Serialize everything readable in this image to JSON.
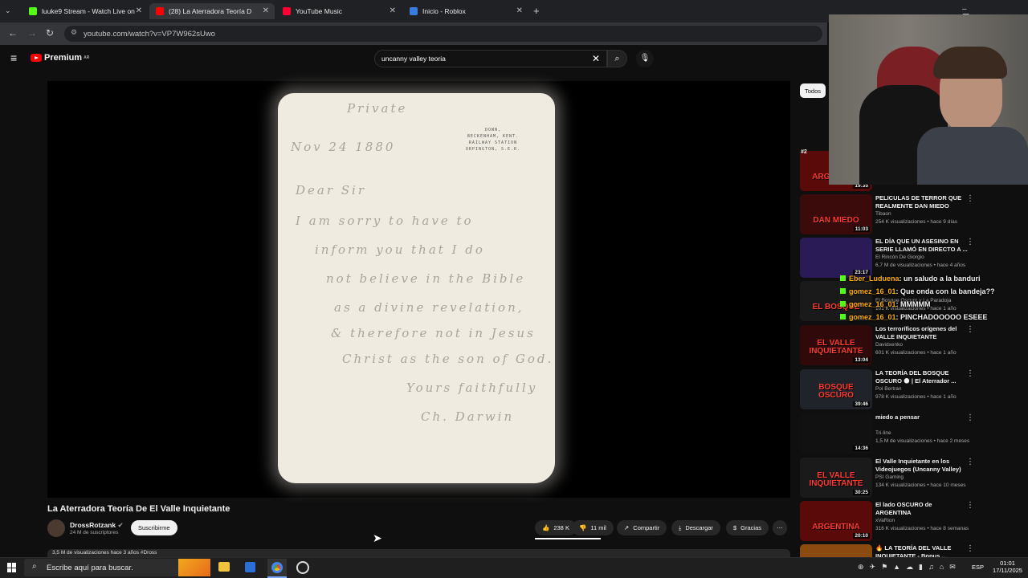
{
  "browser": {
    "tabs": [
      {
        "title": "luuke9 Stream - Watch Live on",
        "color": "#53fc18"
      },
      {
        "title": "(28) La Aterradora Teoría D",
        "color": "#ff0000"
      },
      {
        "title": "YouTube Music",
        "color": "#ff0033"
      },
      {
        "title": "Inicio - Roblox",
        "color": "#3b7bdc"
      }
    ],
    "url": "youtube.com/watch?v=VP7W962sUwo"
  },
  "youtube": {
    "logo_text": "Premium",
    "logo_region": "AR",
    "search_value": "uncanny valley teoria",
    "filter_chip": "Todos"
  },
  "letter": {
    "stamp": [
      "DOWN,",
      "BECKENHAM, KENT.",
      "RAILWAY STATION",
      "ORPINGTON, S.E.R."
    ],
    "lines": [
      "Private",
      "Nov 24 1880",
      "Dear Sir",
      "I am sorry to have to",
      "inform you that I do",
      "not believe in the Bible",
      "as a divine revelation,",
      "& therefore not in Jesus",
      "Christ as the son of God.",
      "Yours faithfully",
      "Ch. Darwin"
    ]
  },
  "video": {
    "title": "La Aterradora Teoría De El Valle Inquietante",
    "channel": "DrossRotzank",
    "subscribers": "24 M de suscriptores",
    "subscribe_label": "Suscribirme",
    "likes": "238 K",
    "dislikes": "11 mil",
    "share": "Compartir",
    "download": "Descargar",
    "thanks": "Gracias",
    "views_line": "3,5 M de visualizaciones  hace 3 años  #Dross"
  },
  "recommendations": [
    {
      "title": "",
      "channel": "",
      "meta": "",
      "duration": "19:35",
      "thumb_text": "ARGENTINA",
      "thumb_color": "#5a0a08"
    },
    {
      "title": "PELICULAS DE TERROR QUE REALMENTE DAN MIEDO",
      "channel": "Tibaon",
      "meta": "254 K visualizaciones • hace 9 días",
      "duration": "11:03",
      "thumb_text": "DAN MIEDO",
      "thumb_color": "#3b0a0a"
    },
    {
      "title": "EL DÍA QUE UN ASESINO EN SERIE LLAMÓ EN DIRECTO A ...",
      "channel": "El Rincón De Giorgio",
      "meta": "6,7 M de visualizaciones • hace 4 años",
      "duration": "23:17",
      "thumb_text": "",
      "thumb_color": "#2a1a55"
    },
    {
      "title": "",
      "channel": "El Bosque Oscuro y La Paradoja",
      "meta": "101 K visualizaciones • hace 1 año",
      "duration": "",
      "thumb_text": "EL BOSQUE",
      "thumb_color": "#1a1a1a"
    },
    {
      "title": "Los terroríficos orígenes del VALLE INQUIETANTE",
      "channel": "Davidxenko",
      "meta": "601 K visualizaciones • hace 1 año",
      "duration": "13:04",
      "thumb_text": "EL VALLE INQUIETANTE",
      "thumb_color": "#300a0a"
    },
    {
      "title": "LA TEORÍA DEL BOSQUE OSCURO 🌑 | El Aterrador ...",
      "channel": "Pol Bertran",
      "meta": "978 K visualizaciones • hace 1 año",
      "duration": "39:46",
      "thumb_text": "BOSQUE OSCURO",
      "thumb_color": "#20242a"
    },
    {
      "title": "miedo a pensar",
      "channel": "Tri-line",
      "meta": "1,5 M de visualizaciones • hace 2 meses",
      "duration": "14:36",
      "thumb_text": "",
      "thumb_color": "#111"
    },
    {
      "title": "El Valle Inquietante en los Videojuegos (Uncanny Valley)",
      "channel": "PSI Gaming",
      "meta": "134 K visualizaciones • hace 10 meses",
      "duration": "30:25",
      "thumb_text": "EL VALLE INQUIETANTE",
      "thumb_color": "#1a1a1a"
    },
    {
      "title": "El lado OSCURO de ARGENTINA",
      "channel": "xVaRion",
      "meta": "316 K visualizaciones • hace 8 semanas",
      "duration": "20:10",
      "thumb_text": "ARGENTINA",
      "thumb_color": "#5a0a08"
    },
    {
      "title": "🔥 LA TEORÍA DEL VALLE INQUIETANTE - Bonus ...",
      "channel": "",
      "meta": "",
      "duration": "",
      "thumb_text": "",
      "thumb_color": "#8a4a10"
    }
  ],
  "chat": [
    {
      "user": "Eber_Luduena",
      "msg": ": un saludo a la banduri"
    },
    {
      "user": "gomez_16_01",
      "msg": ": Que onda con la bandeja??"
    },
    {
      "user": "gomez_16_01",
      "msg": ": MMMMM"
    },
    {
      "user": "gomez_16_01",
      "msg": ": PINCHADOOOOO ESEEE"
    }
  ],
  "webcam": {
    "rank": "#2"
  },
  "taskbar": {
    "search_placeholder": "Escribe aquí para buscar.",
    "language": "ESP",
    "time": "01:01",
    "date": "17/11/2025"
  }
}
